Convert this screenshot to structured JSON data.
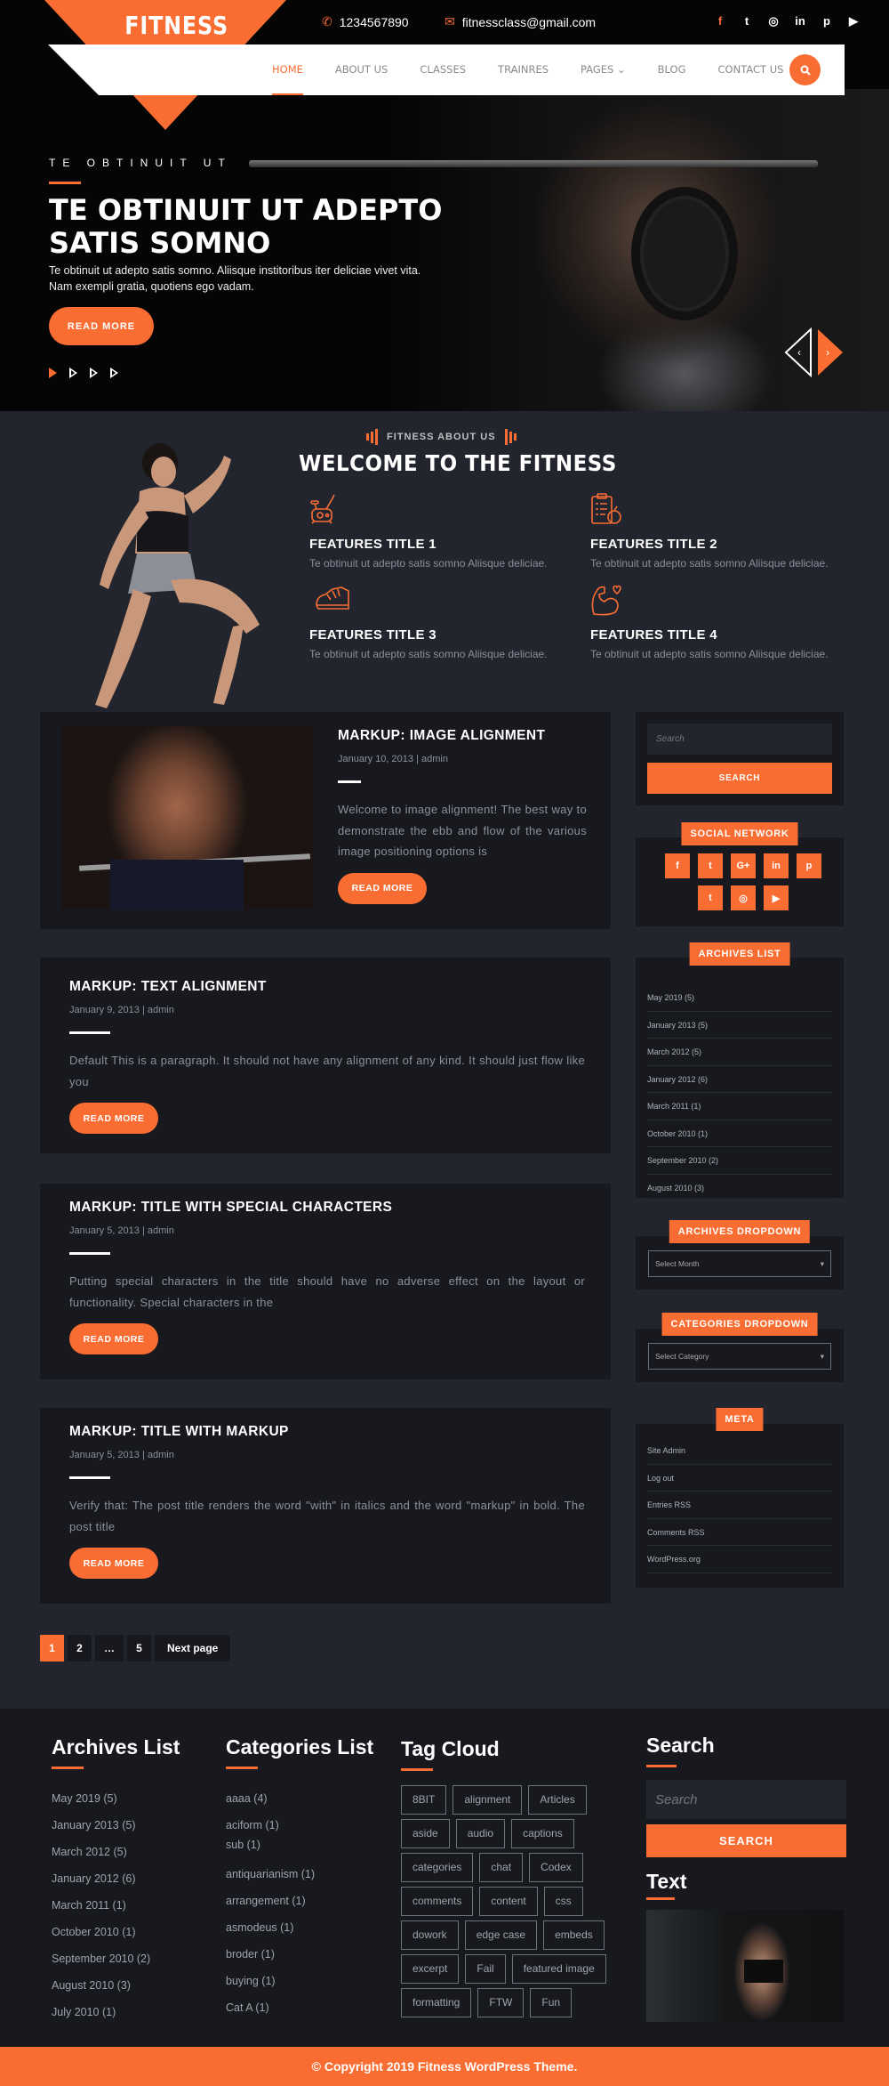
{
  "brand": {
    "name": "FITNESS",
    "accent": "#f96d33",
    "background": "#22252d",
    "panel": "#18191e"
  },
  "topbar": {
    "phone": "1234567890",
    "email": "fitnessclass@gmail.com",
    "social": [
      "facebook",
      "twitter",
      "instagram",
      "linkedin",
      "pinterest",
      "youtube"
    ],
    "social_glyphs": [
      "f",
      "t",
      "◎",
      "in",
      "p",
      "▶"
    ]
  },
  "nav": {
    "items": [
      {
        "label": "HOME",
        "active": true
      },
      {
        "label": "ABOUT US"
      },
      {
        "label": "CLASSES"
      },
      {
        "label": "TRAINRES"
      },
      {
        "label": "PAGES ⌄"
      },
      {
        "label": "BLOG"
      },
      {
        "label": "CONTACT US"
      }
    ]
  },
  "hero": {
    "kicker": "TE OBTINUIT UT",
    "title": "TE OBTINUIT UT ADEPTO SATIS SOMNO",
    "description": "Te obtinuit ut adepto satis somno. Aliisque institoribus iter deliciae vivet vita. Nam exempli gratia, quotiens ego vadam.",
    "button": "READ MORE",
    "slide_count": 4,
    "active_slide": 1,
    "prev": "‹",
    "next": "›"
  },
  "about": {
    "kicker": "FITNESS ABOUT US",
    "title": "WELCOME TO THE FITNESS",
    "features": [
      {
        "icon": "exercise-bike-icon",
        "title": "FEATURES TITLE 1",
        "desc": "Te obtinuit ut adepto satis somno Aliisque deliciae."
      },
      {
        "icon": "diet-clipboard-icon",
        "title": "FEATURES TITLE 2",
        "desc": "Te obtinuit ut adepto satis somno Aliisque deliciae."
      },
      {
        "icon": "sneaker-icon",
        "title": "FEATURES TITLE 3",
        "desc": "Te obtinuit ut adepto satis somno Aliisque deliciae."
      },
      {
        "icon": "muscle-heart-icon",
        "title": "FEATURES TITLE 4",
        "desc": "Te obtinuit ut adepto satis somno Aliisque deliciae."
      }
    ]
  },
  "posts": [
    {
      "title": "MARKUP: IMAGE ALIGNMENT",
      "date": "January 10, 2013",
      "author": "admin",
      "excerpt": "Welcome to image alignment! The best way to demonstrate the ebb and flow of the various image positioning options is",
      "button": "READ MORE"
    },
    {
      "title": "MARKUP: TEXT ALIGNMENT",
      "date": "January 9, 2013",
      "author": "admin",
      "excerpt": "Default This is a paragraph. It should not have any alignment of any kind. It should just flow like you",
      "button": "READ MORE"
    },
    {
      "title": "MARKUP: TITLE WITH SPECIAL CHARACTERS",
      "date": "January 5, 2013",
      "author": "admin",
      "excerpt": "Putting special characters in the title should have no adverse effect on the layout or functionality. Special characters in the",
      "button": "READ MORE"
    },
    {
      "title": "MARKUP: TITLE WITH MARKUP",
      "date": "January 5, 2013",
      "author": "admin",
      "excerpt": "Verify that: The post title renders the word \"with\" in italics and the word \"markup\" in bold. The post title",
      "button": "READ MORE"
    }
  ],
  "pagination": {
    "pages": [
      "1",
      "2",
      "…",
      "5"
    ],
    "current": "1",
    "next": "Next page"
  },
  "sidebar": {
    "search": {
      "placeholder": "Search",
      "button": "SEARCH"
    },
    "social": {
      "label": "SOCIAL NETWORK",
      "icons": [
        "f",
        "t",
        "G+",
        "in",
        "p",
        "t",
        "◎",
        "▶"
      ],
      "names": [
        "facebook",
        "twitter",
        "google-plus",
        "linkedin",
        "pinterest",
        "tumblr",
        "instagram",
        "youtube"
      ]
    },
    "archives": {
      "label": "ARCHIVES LIST",
      "items": [
        "May 2019 (5)",
        "January 2013 (5)",
        "March 2012 (5)",
        "January 2012 (6)",
        "March 2011 (1)",
        "October 2010 (1)",
        "September 2010 (2)",
        "August 2010 (3)"
      ]
    },
    "archives_dropdown": {
      "label": "ARCHIVES DROPDOWN",
      "value": "Select Month"
    },
    "categories_dropdown": {
      "label": "CATEGORIES DROPDOWN",
      "value": "Select Category"
    },
    "meta": {
      "label": "META",
      "items": [
        "Site Admin",
        "Log out",
        "Entries RSS",
        "Comments RSS",
        "WordPress.org"
      ]
    }
  },
  "footer": {
    "archives": {
      "title": "Archives List",
      "items": [
        "May 2019 (5)",
        "January 2013 (5)",
        "March 2012 (5)",
        "January 2012 (6)",
        "March 2011 (1)",
        "October 2010 (1)",
        "September 2010 (2)",
        "August 2010 (3)",
        "July 2010 (1)"
      ]
    },
    "categories": {
      "title": "Categories List",
      "items": [
        "aaaa (4)",
        "aciform (1)",
        "sub (1)",
        "antiquarianism (1)",
        "arrangement (1)",
        "asmodeus (1)",
        "broder (1)",
        "buying (1)",
        "Cat A (1)"
      ]
    },
    "tags": {
      "title": "Tag Cloud",
      "items": [
        "8BIT",
        "alignment",
        "Articles",
        "aside",
        "audio",
        "captions",
        "categories",
        "chat",
        "Codex",
        "comments",
        "content",
        "css",
        "dowork",
        "edge case",
        "embeds",
        "excerpt",
        "Fail",
        "featured image",
        "formatting",
        "FTW",
        "Fun"
      ]
    },
    "search": {
      "title": "Search",
      "placeholder": "Search",
      "button": "SEARCH"
    },
    "text": {
      "title": "Text"
    },
    "copyright": "© Copyright 2019 Fitness WordPress Theme."
  }
}
